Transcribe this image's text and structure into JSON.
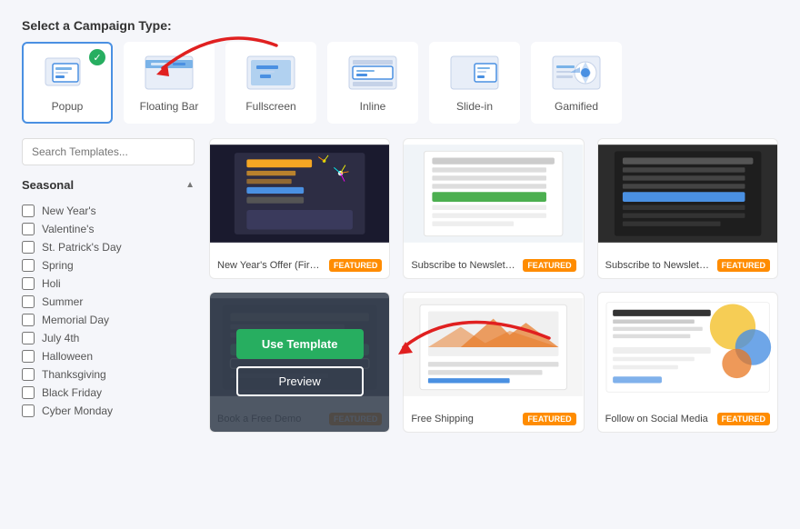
{
  "header": {
    "campaign_type_label": "Select a Campaign Type:"
  },
  "campaign_types": [
    {
      "id": "popup",
      "label": "Popup",
      "selected": true
    },
    {
      "id": "floating-bar",
      "label": "Floating Bar",
      "selected": false
    },
    {
      "id": "fullscreen",
      "label": "Fullscreen",
      "selected": false
    },
    {
      "id": "inline",
      "label": "Inline",
      "selected": false
    },
    {
      "id": "slide-in",
      "label": "Slide-in",
      "selected": false
    },
    {
      "id": "gamified",
      "label": "Gamified",
      "selected": false
    }
  ],
  "sidebar": {
    "search_placeholder": "Search Templates...",
    "section_label": "Seasonal",
    "filters": [
      "New Year's",
      "Valentine's",
      "St. Patrick's Day",
      "Spring",
      "Holi",
      "Summer",
      "Memorial Day",
      "July 4th",
      "Halloween",
      "Thanksgiving",
      "Black Friday",
      "Cyber Monday"
    ]
  },
  "templates": [
    {
      "id": "new-years-offer",
      "name": "New Year's Offer (Firewо...",
      "featured": true,
      "theme": "dark-fireworks"
    },
    {
      "id": "subscribe-newsletter-1",
      "name": "Subscribe to Newsletter ...",
      "featured": true,
      "theme": "light-newsletter"
    },
    {
      "id": "subscribe-newsletter-2",
      "name": "Subscribe to Newsletter ...",
      "featured": true,
      "theme": "dark-newsletter"
    },
    {
      "id": "book-demo",
      "name": "Book a Free Demo",
      "featured": true,
      "theme": "dark-demo",
      "hovered": true
    },
    {
      "id": "free-shipping",
      "name": "Free Shipping",
      "featured": true,
      "theme": "light-shipping"
    },
    {
      "id": "follow-social",
      "name": "Follow on Social Media",
      "featured": true,
      "theme": "light-social"
    }
  ],
  "buttons": {
    "use_template": "Use Template",
    "preview": "Preview"
  },
  "badges": {
    "featured": "FEATURED"
  }
}
